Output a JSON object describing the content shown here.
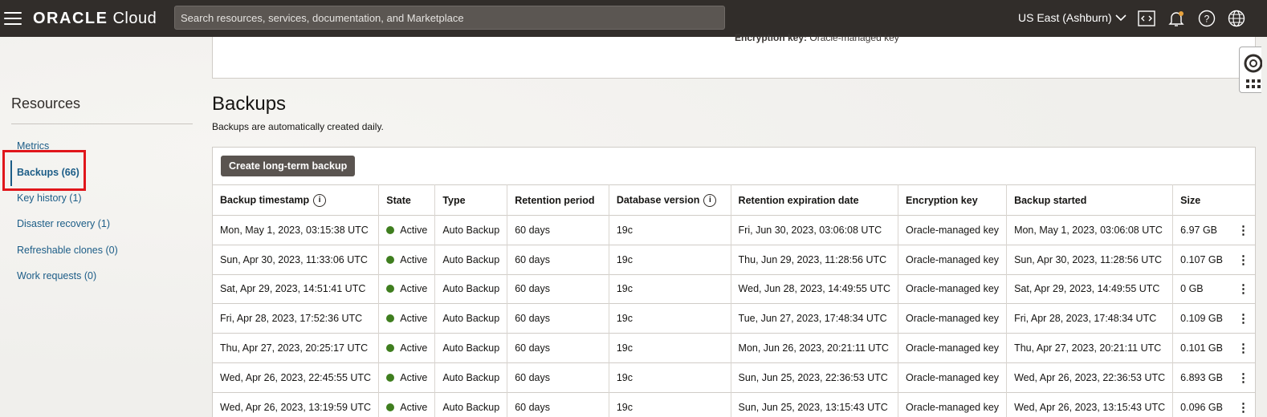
{
  "header": {
    "logo_main": "ORACLE",
    "logo_sub": "Cloud",
    "search_placeholder": "Search resources, services, documentation, and Marketplace",
    "region": "US East (Ashburn)"
  },
  "top_card": {
    "encryption_label": "Encryption key:",
    "encryption_value": "Oracle-managed key"
  },
  "sidebar": {
    "title": "Resources",
    "items": [
      {
        "label": "Metrics"
      },
      {
        "label": "Backups (66)"
      },
      {
        "label": "Key history (1)"
      },
      {
        "label": "Disaster recovery (1)"
      },
      {
        "label": "Refreshable clones (0)"
      },
      {
        "label": "Work requests (0)"
      }
    ]
  },
  "backups": {
    "title": "Backups",
    "subtitle": "Backups are automatically created daily.",
    "create_button": "Create long-term backup",
    "columns": [
      "Backup timestamp",
      "State",
      "Type",
      "Retention period",
      "Database version",
      "Retention expiration date",
      "Encryption key",
      "Backup started",
      "Size"
    ],
    "rows": [
      {
        "timestamp": "Mon, May 1, 2023, 03:15:38 UTC",
        "state": "Active",
        "type": "Auto Backup",
        "retention": "60 days",
        "version": "19c",
        "expiration": "Fri, Jun 30, 2023, 03:06:08 UTC",
        "key": "Oracle-managed key",
        "started": "Mon, May 1, 2023, 03:06:08 UTC",
        "size": "6.97 GB"
      },
      {
        "timestamp": "Sun, Apr 30, 2023, 11:33:06 UTC",
        "state": "Active",
        "type": "Auto Backup",
        "retention": "60 days",
        "version": "19c",
        "expiration": "Thu, Jun 29, 2023, 11:28:56 UTC",
        "key": "Oracle-managed key",
        "started": "Sun, Apr 30, 2023, 11:28:56 UTC",
        "size": "0.107 GB"
      },
      {
        "timestamp": "Sat, Apr 29, 2023, 14:51:41 UTC",
        "state": "Active",
        "type": "Auto Backup",
        "retention": "60 days",
        "version": "19c",
        "expiration": "Wed, Jun 28, 2023, 14:49:55 UTC",
        "key": "Oracle-managed key",
        "started": "Sat, Apr 29, 2023, 14:49:55 UTC",
        "size": "0 GB"
      },
      {
        "timestamp": "Fri, Apr 28, 2023, 17:52:36 UTC",
        "state": "Active",
        "type": "Auto Backup",
        "retention": "60 days",
        "version": "19c",
        "expiration": "Tue, Jun 27, 2023, 17:48:34 UTC",
        "key": "Oracle-managed key",
        "started": "Fri, Apr 28, 2023, 17:48:34 UTC",
        "size": "0.109 GB"
      },
      {
        "timestamp": "Thu, Apr 27, 2023, 20:25:17 UTC",
        "state": "Active",
        "type": "Auto Backup",
        "retention": "60 days",
        "version": "19c",
        "expiration": "Mon, Jun 26, 2023, 20:21:11 UTC",
        "key": "Oracle-managed key",
        "started": "Thu, Apr 27, 2023, 20:21:11 UTC",
        "size": "0.101 GB"
      },
      {
        "timestamp": "Wed, Apr 26, 2023, 22:45:55 UTC",
        "state": "Active",
        "type": "Auto Backup",
        "retention": "60 days",
        "version": "19c",
        "expiration": "Sun, Jun 25, 2023, 22:36:53 UTC",
        "key": "Oracle-managed key",
        "started": "Wed, Apr 26, 2023, 22:36:53 UTC",
        "size": "6.893 GB"
      },
      {
        "timestamp": "Wed, Apr 26, 2023, 13:19:59 UTC",
        "state": "Active",
        "type": "Auto Backup",
        "retention": "60 days",
        "version": "19c",
        "expiration": "Sun, Jun 25, 2023, 13:15:43 UTC",
        "key": "Oracle-managed key",
        "started": "Wed, Apr 26, 2023, 13:15:43 UTC",
        "size": "0.096 GB"
      }
    ]
  },
  "colors": {
    "header_bg": "#312d2a",
    "link": "#1c5d87",
    "active_dot": "#3f7e1f",
    "highlight": "#e0161b"
  }
}
